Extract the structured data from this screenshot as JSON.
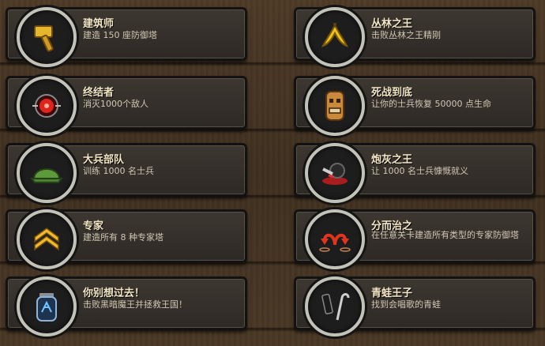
{
  "achievements": [
    {
      "title": "建筑师",
      "desc": "建造 150 座防御塔",
      "icon": "hammer-icon"
    },
    {
      "title": "终结者",
      "desc": "消灭1000个敌人",
      "icon": "target-eye-icon"
    },
    {
      "title": "大兵部队",
      "desc": "训练 1000 名士兵",
      "icon": "helmet-icon"
    },
    {
      "title": "专家",
      "desc": "建造所有 8 种专家塔",
      "icon": "rank-chevron-icon"
    },
    {
      "title": "你别想过去！",
      "desc": "击败黑暗魔王并拯救王国！",
      "icon": "soul-jar-icon"
    },
    {
      "title": "丛林之王",
      "desc": "击败丛林之王精刚",
      "icon": "banana-icon"
    },
    {
      "title": "死战到底",
      "desc": "让你的士兵恢复 50000 点生命",
      "icon": "tiki-idol-icon"
    },
    {
      "title": "炮灰之王",
      "desc": "让 1000 名士兵慷慨就义",
      "icon": "fallen-soldier-icon"
    },
    {
      "title": "分而治之",
      "desc": "在任意关卡建造所有类型的专家防御塔",
      "icon": "split-arrows-icon"
    },
    {
      "title": "青蛙王子",
      "desc": "找到会唱歌的青蛙",
      "icon": "frog-cane-icon"
    }
  ]
}
